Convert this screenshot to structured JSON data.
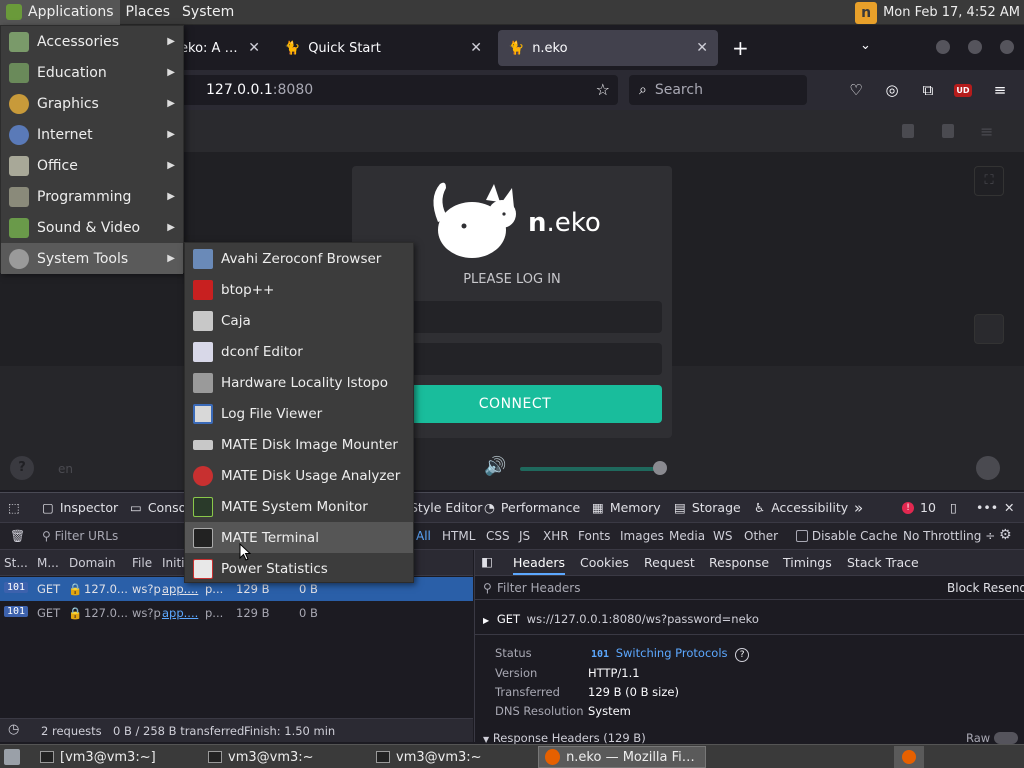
{
  "top_panel": {
    "applications": "Applications",
    "places": "Places",
    "system": "System",
    "clock": "Mon Feb 17,  4:52 AM"
  },
  "browser": {
    "tabs": [
      {
        "label": "eko: A self"
      },
      {
        "label": "Quick Start"
      },
      {
        "label": "n.eko"
      }
    ],
    "url_host": "127.0.0.1",
    "url_port": ":8080",
    "search_placeholder": "Search",
    "ext_badge": "UD"
  },
  "neko": {
    "logo_n": "n",
    "logo_rest": ".eko",
    "prompt": "PLEASE LOG IN",
    "connect_label": "CONNECT",
    "lang": "en"
  },
  "devtools": {
    "tabs": [
      "Inspector",
      "Console",
      "Style Editor",
      "Performance",
      "Memory",
      "Storage",
      "Accessibility"
    ],
    "error_count": "10",
    "filter_placeholder": "Filter URLs",
    "types": [
      "All",
      "HTML",
      "CSS",
      "JS",
      "XHR",
      "Fonts",
      "Images",
      "Media",
      "WS",
      "Other"
    ],
    "disable_cache": "Disable Cache",
    "throttling": "No Throttling ÷",
    "columns": [
      "St...",
      "M...",
      "Domain",
      "File",
      "Initi"
    ],
    "requests": [
      {
        "status": "101",
        "method": "GET",
        "domain": "127.0...",
        "file": "ws?p",
        "initiator": "app....",
        "type": "p...",
        "transferred": "129 B",
        "size": "0 B"
      },
      {
        "status": "101",
        "method": "GET",
        "domain": "127.0...",
        "file": "ws?p",
        "initiator": "app....",
        "type": "p...",
        "transferred": "129 B",
        "size": "0 B"
      }
    ],
    "summary": {
      "requests": "2 requests",
      "transferred": "0 B / 258 B transferred",
      "finish": "Finish: 1.50 min"
    },
    "detail_tabs": [
      "Headers",
      "Cookies",
      "Request",
      "Response",
      "Timings",
      "Stack Trace"
    ],
    "filter_headers": "Filter Headers",
    "block": "Block",
    "resend": "Resend",
    "request_line": {
      "method": "GET",
      "url": "ws://127.0.0.1:8080/ws?password=neko"
    },
    "headers": {
      "status_label": "Status",
      "status_code": "101",
      "status_text": "Switching Protocols",
      "version_label": "Version",
      "version": "HTTP/1.1",
      "transferred_label": "Transferred",
      "transferred": "129 B (0 B size)",
      "dns_label": "DNS Resolution",
      "dns": "System"
    },
    "response_headers": "Response Headers (129 B)",
    "raw": "Raw"
  },
  "taskbar": {
    "items": [
      "[vm3@vm3:~]",
      "vm3@vm3:~",
      "vm3@vm3:~",
      "n.eko — Mozilla Fire..."
    ]
  },
  "apps_menu": {
    "items": [
      "Accessories",
      "Education",
      "Graphics",
      "Internet",
      "Office",
      "Programming",
      "Sound & Video",
      "System Tools"
    ]
  },
  "system_tools_menu": {
    "items": [
      "Avahi Zeroconf Browser",
      "btop++",
      "Caja",
      "dconf Editor",
      "Hardware Locality lstopo",
      "Log File Viewer",
      "MATE Disk Image Mounter",
      "MATE Disk Usage Analyzer",
      "MATE System Monitor",
      "MATE Terminal",
      "Power Statistics"
    ]
  },
  "colors": {
    "accent_teal": "#19bd9c",
    "menu_bg": "#3c3c3c",
    "firefox_dark": "#1c1b22",
    "selected_row": "#2a5fa8"
  }
}
